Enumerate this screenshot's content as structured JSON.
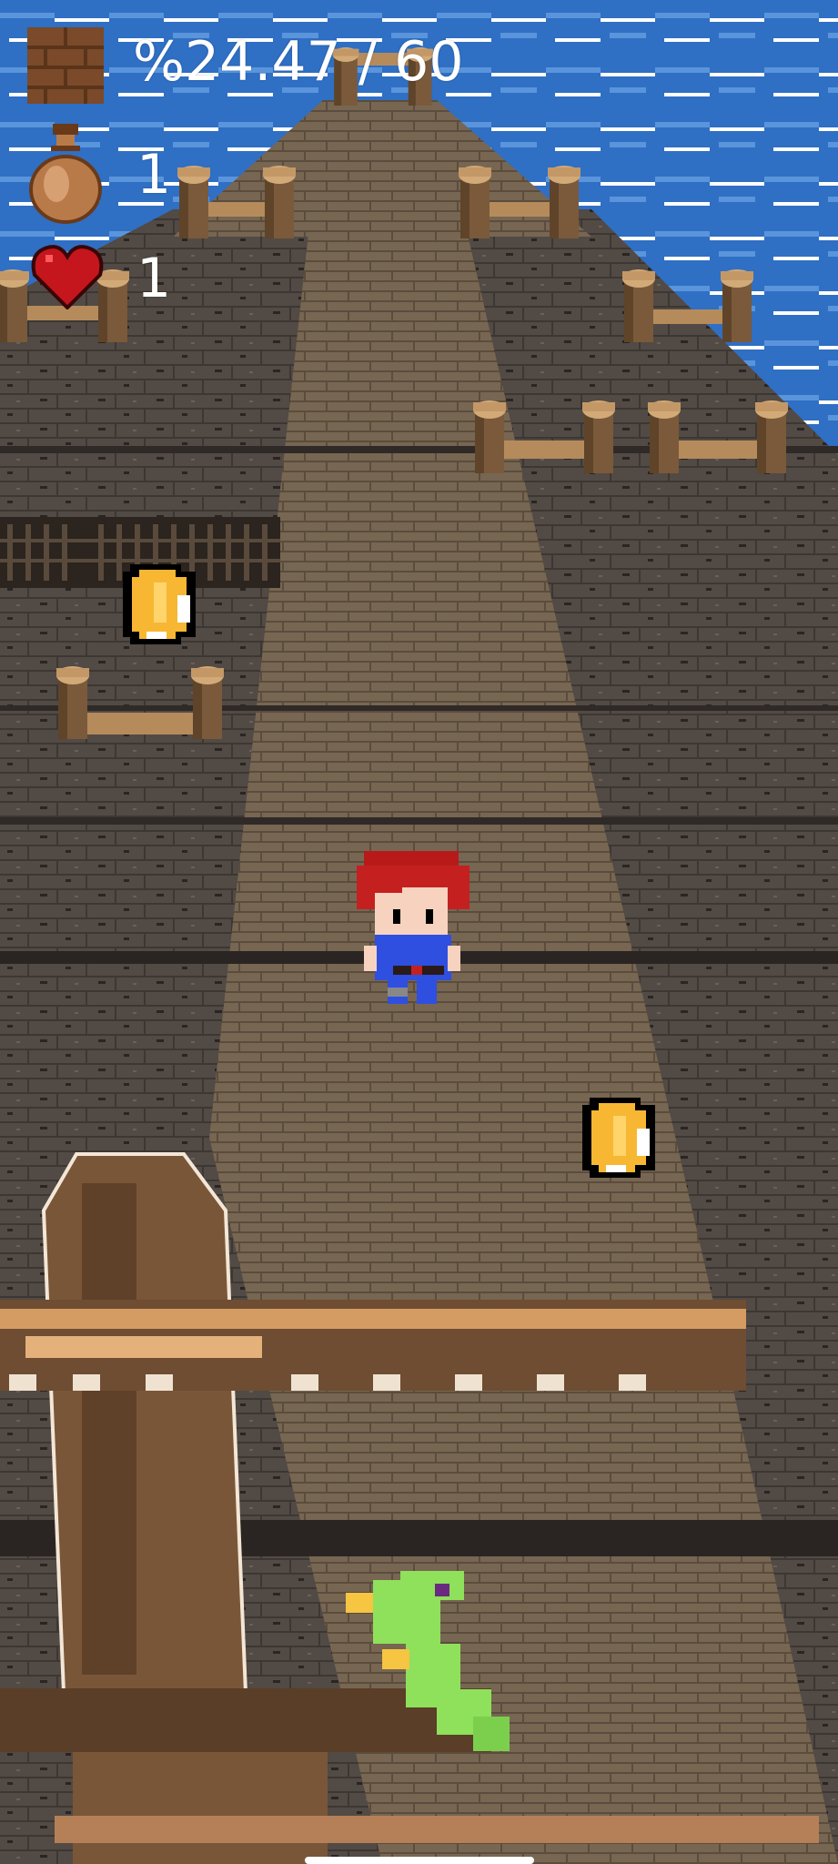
{
  "hud": {
    "progress": {
      "icon": "brick-block-icon",
      "text": "%24.47 / 60",
      "current": 24.47,
      "target": 60
    },
    "bags": {
      "icon": "money-bag-icon",
      "count": "1"
    },
    "lives": {
      "icon": "heart-icon",
      "count": "1"
    }
  },
  "scene": {
    "player": "red-haired-boy",
    "pickups": [
      "gold-coin",
      "gold-coin"
    ],
    "enemy": "green-parrot",
    "foreground": "wooden-mast-cross"
  },
  "colors": {
    "sea": "#2f6fc4",
    "deck": "#5b5148",
    "walkway": "#7a6a55",
    "coin": "#f7b733",
    "parrot": "#8fe05a",
    "heart": "#c4161c",
    "hud_text": "#ffffff"
  }
}
